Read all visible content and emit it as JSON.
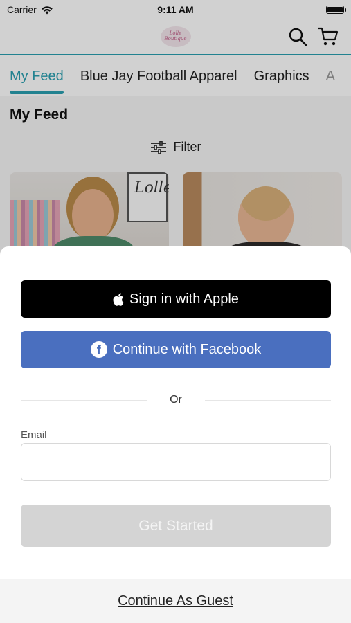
{
  "status_bar": {
    "carrier": "Carrier",
    "time": "9:11 AM"
  },
  "header": {
    "logo_text": "Lolle Boutique",
    "icons": [
      "search-icon",
      "cart-icon"
    ]
  },
  "tabs": [
    {
      "label": "My Feed",
      "active": true
    },
    {
      "label": "Blue Jay Football Apparel",
      "active": false
    },
    {
      "label": "Graphics",
      "active": false
    },
    {
      "label": "A",
      "active": false
    }
  ],
  "feed": {
    "title": "My Feed",
    "filter_label": "Filter",
    "frame_text": "Lolle"
  },
  "sheet": {
    "apple_label": "Sign in with Apple",
    "facebook_label": "Continue with Facebook",
    "divider_text": "Or",
    "email_label": "Email",
    "email_value": "",
    "email_placeholder": "",
    "get_started_label": "Get Started",
    "guest_label": "Continue As Guest"
  },
  "colors": {
    "accent": "#2a9fb0",
    "facebook": "#4a6fbf",
    "apple": "#000000",
    "disabled_button": "#d4d4d4"
  }
}
